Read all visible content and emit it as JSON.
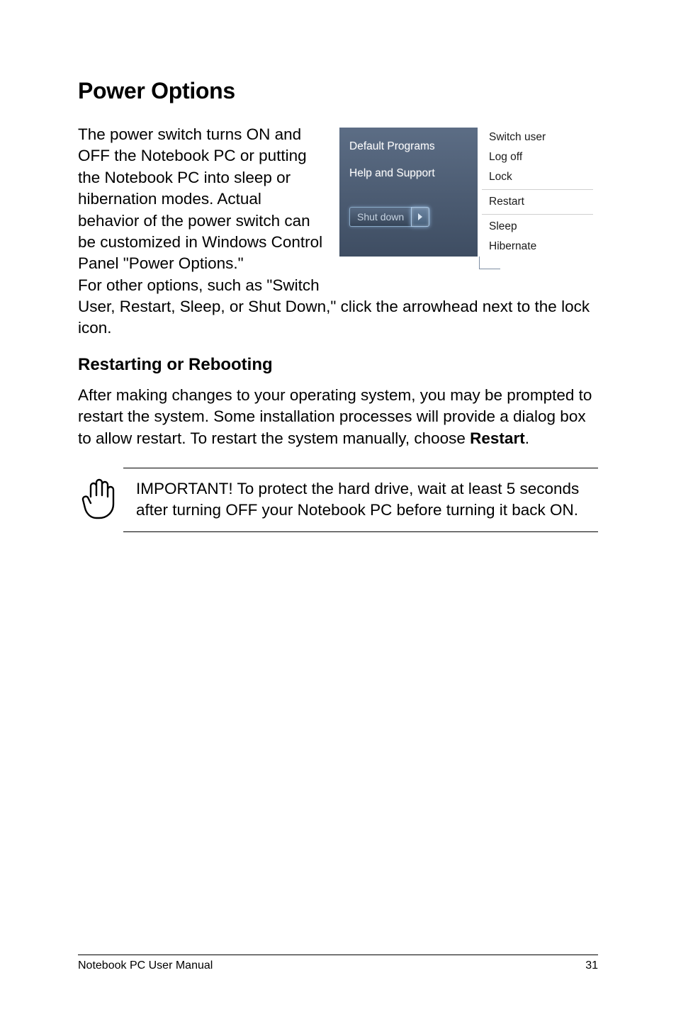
{
  "heading": "Power Options",
  "para1": "The power switch turns ON and OFF the Notebook PC or putting the Notebook PC into sleep or hibernation modes. Actual behavior of the power switch can be customized in Windows Control Panel \"Power Options.\"",
  "para1b": "For other options, such as \"Switch",
  "para1c": "User, Restart, Sleep, or Shut Down,\" click the arrowhead next to the lock icon.",
  "subheading": "Restarting or Rebooting",
  "para2a": "After making changes to your operating system, you may be prompted to restart the system. Some installation processes will provide a dialog box to allow restart. To restart the system manually, choose ",
  "para2b": "Restart",
  "para2c": ".",
  "important": "IMPORTANT!  To protect the hard drive, wait at least 5 seconds after turning OFF your Notebook PC before turning it back ON.",
  "menu": {
    "left_items": [
      "Default Programs",
      "Help and Support"
    ],
    "shutdown_label": "Shut down",
    "right_items": [
      "Switch user",
      "Log off",
      "Lock",
      "Restart",
      "Sleep",
      "Hibernate"
    ]
  },
  "footer": {
    "left": "Notebook PC User Manual",
    "right": "31"
  }
}
